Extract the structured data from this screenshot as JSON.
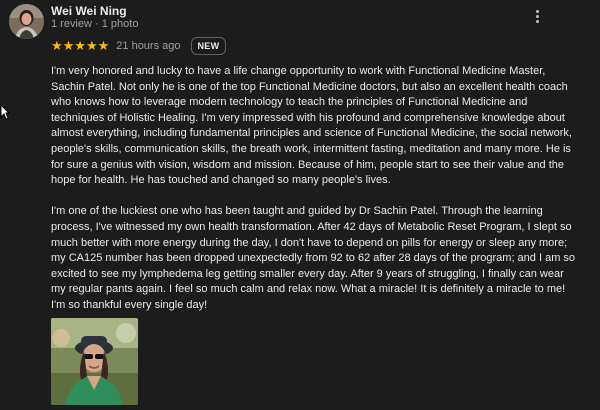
{
  "review": {
    "reviewer_name": "Wei Wei Ning",
    "reviewer_meta": "1 review · 1 photo",
    "stars_glyph": "★★★★★",
    "rating": 5,
    "time_ago": "21 hours ago",
    "badge": "NEW",
    "paragraphs": [
      "I'm very honored and lucky to have a life change opportunity to work with Functional Medicine Master, Sachin Patel. Not only he is one of the top Functional Medicine doctors,  but also an excellent health coach who knows how to leverage modern technology to teach the principles of Functional Medicine and techniques of Holistic Healing. I'm very impressed with his profound and comprehensive knowledge about almost everything, including fundamental principles and science of Functional Medicine, the social network, people's skills, communication skills, the breath work, intermittent fasting, meditation and many more. He is for sure a genius with vision, wisdom and mission.  Because of him, people start to see their value and the hope for health. He has touched and changed so many people's lives.",
      "I'm one of the luckiest one who has been taught and guided by Dr Sachin Patel. Through the learning process, I've witnessed my own health transformation.  After 42 days of Metabolic Reset Program, I slept so much better with more energy during the day, I don't have to depend on pills for energy or sleep any more;  my CA125 number has been dropped unexpectedly from 92 to 62 after 28 days of the program; and I am so excited to see my lymphedema leg getting smaller every day.  After 9 years of struggling, I finally can wear my regular pants again. I feel so much calm and relax now. What a miracle! It is definitely a miracle to me!   I'm so thankful every single day!"
    ]
  },
  "colors": {
    "background": "#1c1c1c",
    "text": "#e8eaed",
    "secondary_text": "#9aa0a6",
    "star": "#fbbc04"
  },
  "icons": {
    "avatar": "reviewer-avatar",
    "menu": "more-vertical-icon",
    "cursor": "mouse-cursor-icon"
  }
}
